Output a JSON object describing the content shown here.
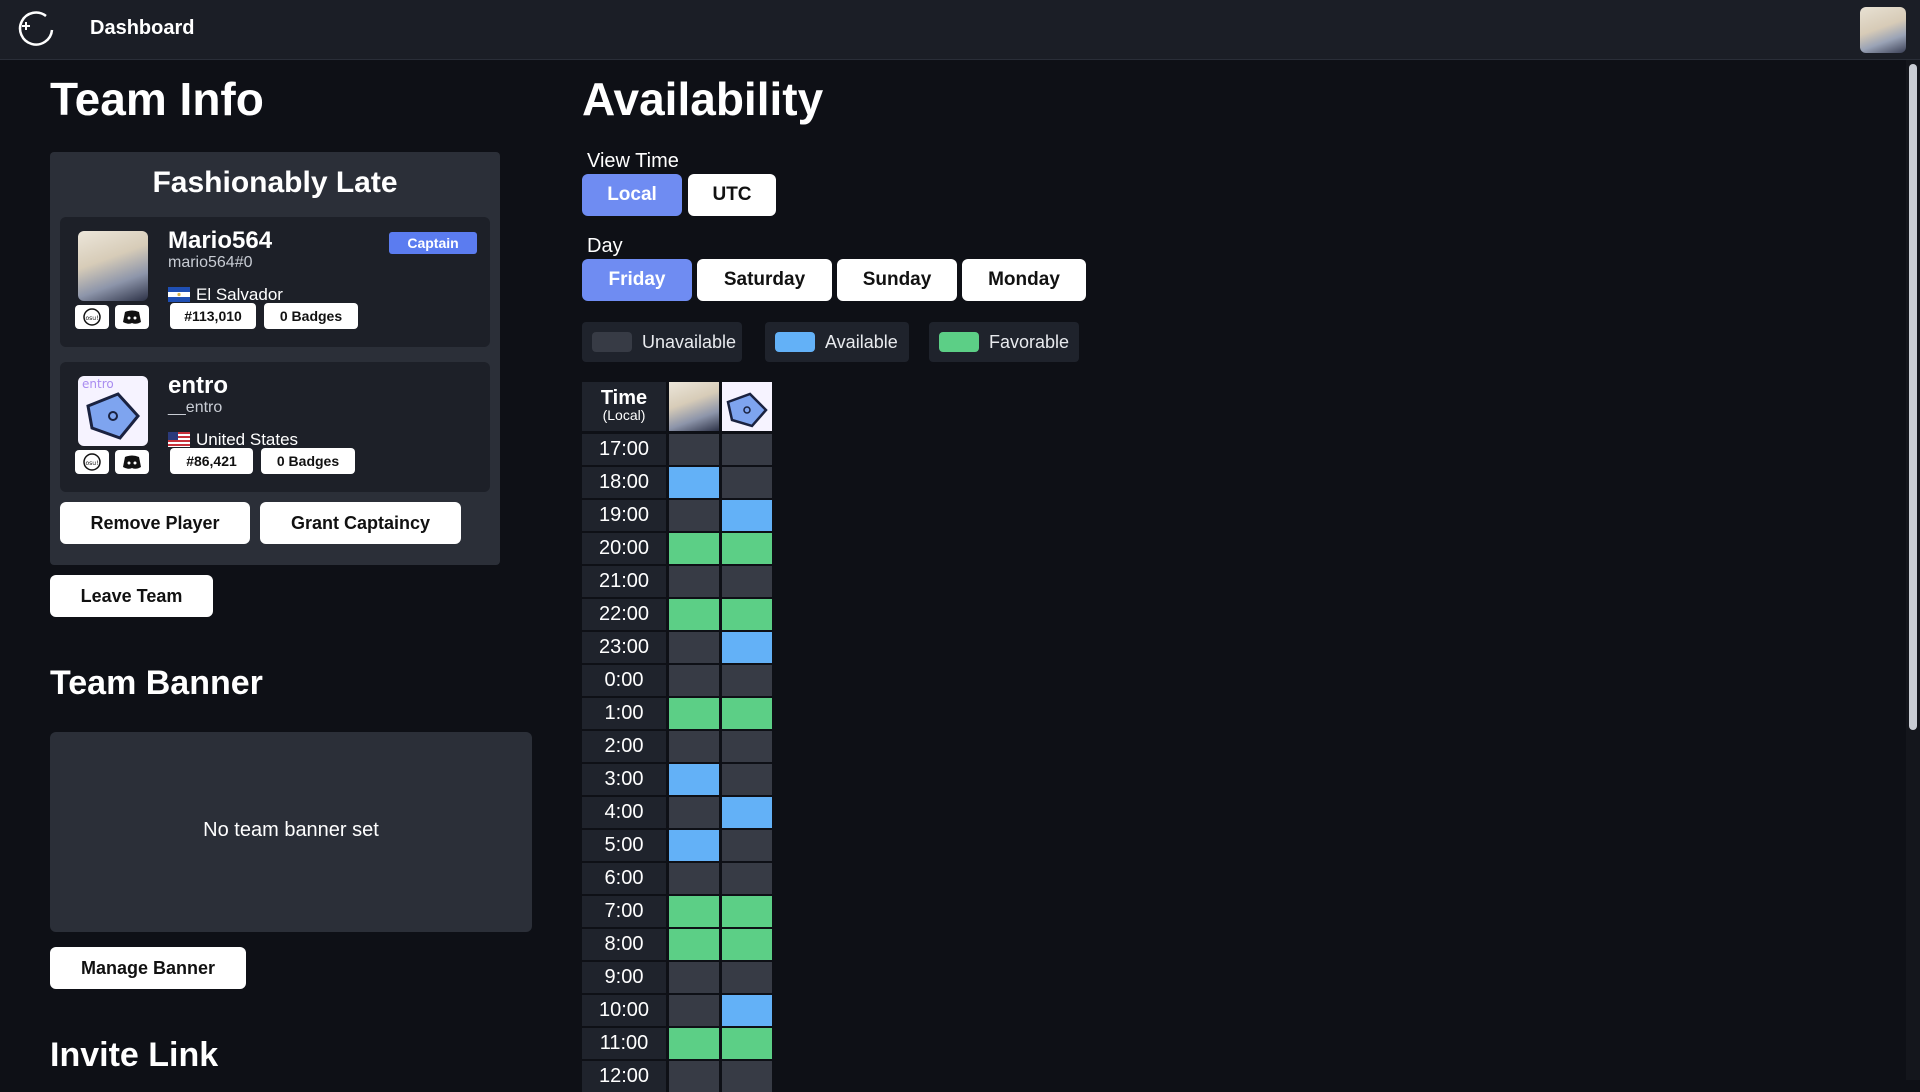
{
  "topbar": {
    "title": "Dashboard",
    "logo_icon": "orbit-logo-icon"
  },
  "team_info": {
    "heading": "Team Info",
    "team_name": "Fashionably Late",
    "players": [
      {
        "name": "Mario564",
        "handle": "mario564#0",
        "country": "El Salvador",
        "rank": "#113,010",
        "badges": "0 Badges",
        "captain_label": "Captain"
      },
      {
        "name": "entro",
        "handle": "__entro",
        "country": "United States",
        "rank": "#86,421",
        "badges": "0 Badges"
      }
    ],
    "remove_player": "Remove Player",
    "grant_captaincy": "Grant Captaincy",
    "leave_team": "Leave Team"
  },
  "team_banner": {
    "heading": "Team Banner",
    "empty_text": "No team banner set",
    "manage": "Manage Banner"
  },
  "invite_link": {
    "heading": "Invite Link"
  },
  "availability": {
    "heading": "Availability",
    "view_time_label": "View Time",
    "view_time_options": [
      "Local",
      "UTC"
    ],
    "view_time_selected": "Local",
    "day_label": "Day",
    "days": [
      "Friday",
      "Saturday",
      "Sunday",
      "Monday"
    ],
    "day_selected": "Friday",
    "legend": [
      "Unavailable",
      "Available",
      "Favorable"
    ],
    "colors": {
      "unavailable": "#373b45",
      "available": "#63b1f7",
      "favorable": "#5ccf86"
    },
    "header_time": "Time",
    "header_sub": "(Local)",
    "rows": [
      {
        "time": "17:00",
        "mario": "u",
        "entro": "u"
      },
      {
        "time": "18:00",
        "mario": "a",
        "entro": "u"
      },
      {
        "time": "19:00",
        "mario": "u",
        "entro": "a"
      },
      {
        "time": "20:00",
        "mario": "f",
        "entro": "f"
      },
      {
        "time": "21:00",
        "mario": "u",
        "entro": "u"
      },
      {
        "time": "22:00",
        "mario": "f",
        "entro": "f"
      },
      {
        "time": "23:00",
        "mario": "u",
        "entro": "a"
      },
      {
        "time": "0:00",
        "mario": "u",
        "entro": "u"
      },
      {
        "time": "1:00",
        "mario": "f",
        "entro": "f"
      },
      {
        "time": "2:00",
        "mario": "u",
        "entro": "u"
      },
      {
        "time": "3:00",
        "mario": "a",
        "entro": "u"
      },
      {
        "time": "4:00",
        "mario": "u",
        "entro": "a"
      },
      {
        "time": "5:00",
        "mario": "a",
        "entro": "u"
      },
      {
        "time": "6:00",
        "mario": "u",
        "entro": "u"
      },
      {
        "time": "7:00",
        "mario": "f",
        "entro": "f"
      },
      {
        "time": "8:00",
        "mario": "f",
        "entro": "f"
      },
      {
        "time": "9:00",
        "mario": "u",
        "entro": "u"
      },
      {
        "time": "10:00",
        "mario": "u",
        "entro": "a"
      },
      {
        "time": "11:00",
        "mario": "f",
        "entro": "f"
      },
      {
        "time": "12:00",
        "mario": "u",
        "entro": "u"
      }
    ]
  }
}
